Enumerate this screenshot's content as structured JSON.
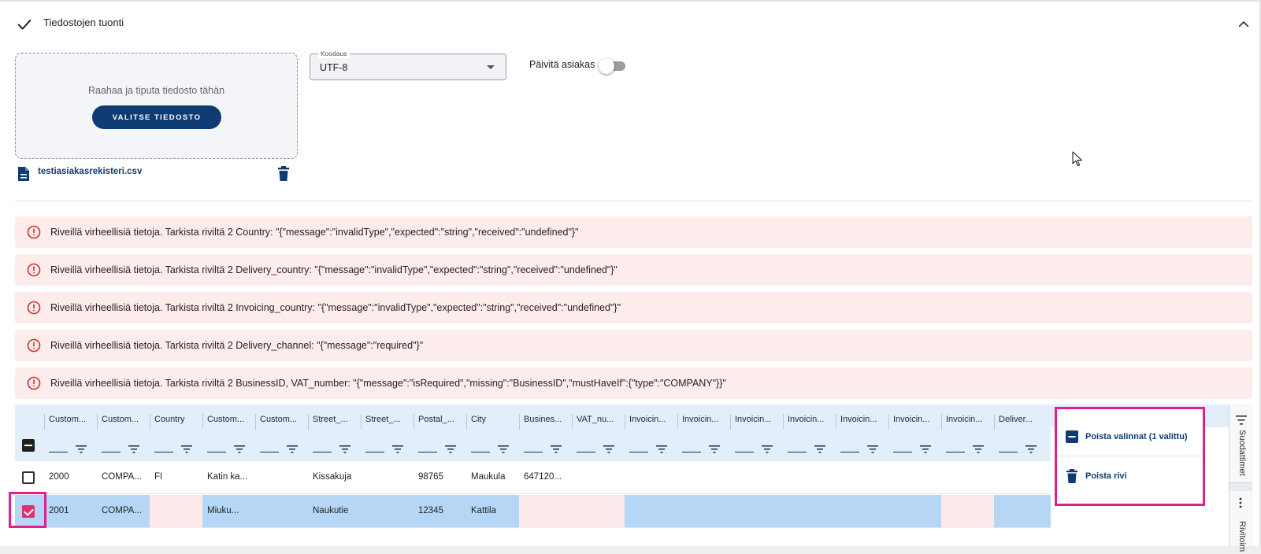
{
  "section": {
    "title": "Tiedostojen tuonti"
  },
  "upload": {
    "dropzone_text": "Raahaa ja tiputa tiedosto tähän",
    "choose_button": "VALITSE TIEDOSTO",
    "file_name": "testiasiakasrekisteri.csv"
  },
  "encoding": {
    "label": "Koodaus",
    "value": "UTF-8"
  },
  "update_customer": {
    "label": "Päivitä asiakas",
    "enabled": false
  },
  "errors": [
    "Riveillä virheellisiä tietoja. Tarkista riviltä 2 Country: \"{\"message\":\"invalidType\",\"expected\":\"string\",\"received\":\"undefined\"}\"",
    "Riveillä virheellisiä tietoja. Tarkista riviltä 2 Delivery_country: \"{\"message\":\"invalidType\",\"expected\":\"string\",\"received\":\"undefined\"}\"",
    "Riveillä virheellisiä tietoja. Tarkista riviltä 2 Invoicing_country: \"{\"message\":\"invalidType\",\"expected\":\"string\",\"received\":\"undefined\"}\"",
    "Riveillä virheellisiä tietoja. Tarkista riviltä 2 Delivery_channel: \"{\"message\":\"required\"}\"",
    "Riveillä virheellisiä tietoja. Tarkista riviltä 2 BusinessID, VAT_number: \"{\"message\":\"isRequired\",\"missing\":\"BusinessID\",\"mustHaveIf\":{\"type\":\"COMPANY\"}}\""
  ],
  "grid": {
    "columns": [
      "Custom...",
      "Custom...",
      "Country",
      "Custom...",
      "Custom...",
      "Street_...",
      "Street_...",
      "Postal_...",
      "City",
      "Busines...",
      "VAT_nu...",
      "Invoicin...",
      "Invoicin...",
      "Invoicin...",
      "Invoicin...",
      "Invoicin...",
      "Invoicin...",
      "Invoicin...",
      "Deliver..."
    ],
    "rows": [
      {
        "selected": false,
        "cells": [
          "2000",
          "COMPA...",
          "FI",
          "Katin ka...",
          "",
          "Kissakuja",
          "",
          "98765",
          "Maukula",
          "647120...",
          "",
          "",
          "",
          "",
          "",
          "",
          "",
          "",
          ""
        ]
      },
      {
        "selected": true,
        "cells": [
          "2001",
          "COMPA...",
          "",
          "Miuku...",
          "",
          "Naukutie",
          "",
          "12345",
          "Kattila",
          "",
          "",
          "",
          "",
          "",
          "",
          "",
          "",
          "",
          ""
        ],
        "error_columns": [
          2,
          9,
          10,
          17
        ]
      }
    ]
  },
  "context_menu": {
    "items": [
      {
        "label": "Poista valinnat (1 valittu)",
        "icon": "minus-square-icon"
      },
      {
        "label": "Poista rivi",
        "icon": "trash-icon"
      }
    ]
  },
  "side_tabs": [
    {
      "label": "Suodattimet",
      "icon": "filter-lines-icon"
    },
    {
      "label": "Rivitoim",
      "icon": "more-vertical-icon"
    }
  ],
  "colors": {
    "primary": "#0f3b73",
    "error_bg": "#fdecec",
    "error_icon": "#d32f2f",
    "grid_header_bg": "#e3eefb",
    "selected_row_bg": "#b5d7f5",
    "highlight": "#e0218a"
  }
}
